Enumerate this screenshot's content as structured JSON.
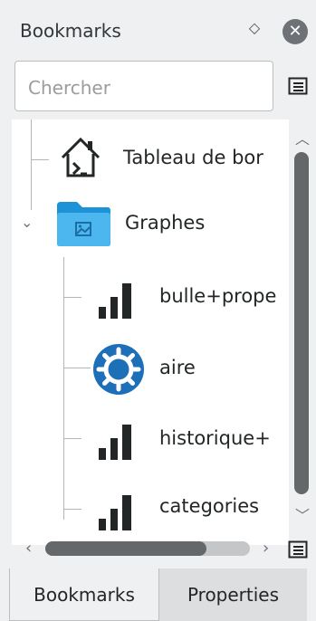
{
  "panel": {
    "title": "Bookmarks",
    "search": {
      "placeholder": "Chercher",
      "value": ""
    }
  },
  "tree": {
    "items": [
      {
        "label": "Tableau de bor",
        "icon": "dashboard-home-icon"
      },
      {
        "label": "Graphes",
        "icon": "folder-icon",
        "expanded": true
      },
      {
        "label": "bulle+prope",
        "icon": "bar-signal-icon"
      },
      {
        "label": "aire",
        "icon": "kde-gear-icon"
      },
      {
        "label": "historique+",
        "icon": "bar-signal-icon"
      },
      {
        "label": "categories",
        "icon": "bar-signal-icon"
      }
    ]
  },
  "tabs": [
    {
      "label": "Bookmarks",
      "active": true
    },
    {
      "label": "Properties",
      "active": false
    }
  ],
  "colors": {
    "background": "#eff0f1",
    "folder_blue": "#3daee9",
    "gear_blue": "#1d6fb8",
    "scroll_thumb": "#64686b"
  }
}
